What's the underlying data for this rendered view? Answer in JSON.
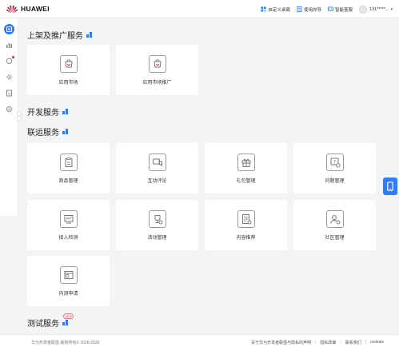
{
  "header": {
    "brand": "HUAWEI",
    "actions": [
      {
        "label": "自定义桌面",
        "icon": "customize-desktop-icon"
      },
      {
        "label": "使用向导",
        "icon": "guide-icon"
      },
      {
        "label": "智能客服",
        "icon": "support-icon"
      }
    ],
    "user": "131*****..."
  },
  "sidebar": {
    "items": [
      "home-icon",
      "chart-icon",
      "message-icon",
      "settings-gear-icon",
      "document-icon",
      "gear-icon"
    ]
  },
  "sections": [
    {
      "title": "上架及推广服务",
      "cards": [
        "应用市场",
        "应用市场推广"
      ]
    },
    {
      "title": "开发服务",
      "cards": []
    },
    {
      "title": "联运服务",
      "cards": [
        "商品管理",
        "互动评论",
        "礼包管理",
        "问题管理",
        "接入检测",
        "活动管理",
        "内容推荐",
        "社区管理",
        "内测申请"
      ]
    },
    {
      "title": "测试服务",
      "badge": "NEW",
      "cards": []
    }
  ],
  "footer": {
    "copyright": "华为开发者联盟 版权所有© 2018-2020",
    "links": [
      "关于华为开发者联盟与隐私的声明",
      "隐私政策",
      "联系我们",
      "cookies"
    ]
  },
  "colors": {
    "accent": "#2f7cf6",
    "brand_red": "#cf0a2c",
    "background": "#f3f4f6"
  }
}
